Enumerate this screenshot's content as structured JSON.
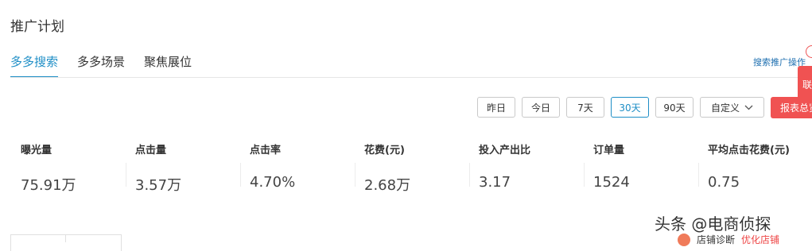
{
  "page": {
    "title": "推广计划"
  },
  "tabs": [
    {
      "label": "多多搜索",
      "active": true
    },
    {
      "label": "多多场景",
      "active": false
    },
    {
      "label": "聚焦展位",
      "active": false
    }
  ],
  "help_link": "搜索推广操作",
  "side_tab_label": "联",
  "date_filters": [
    {
      "label": "昨日",
      "active": false
    },
    {
      "label": "今日",
      "active": false
    },
    {
      "label": "7天",
      "active": false
    },
    {
      "label": "30天",
      "active": true
    },
    {
      "label": "90天",
      "active": false
    }
  ],
  "custom_range": {
    "label": "自定义",
    "icon": "chevron-down-icon"
  },
  "report_button": "报表总览",
  "metrics": [
    {
      "label": "曝光量",
      "value": "75.91万"
    },
    {
      "label": "点击量",
      "value": "3.57万"
    },
    {
      "label": "点击率",
      "value": "4.70%"
    },
    {
      "label": "花费(元)",
      "value": "2.68万"
    },
    {
      "label": "投入产出比",
      "value": "3.17"
    },
    {
      "label": "订单量",
      "value": "1524"
    },
    {
      "label": "平均点击花费(元)",
      "value": "0.75"
    }
  ],
  "watermark": "头条 @电商侦探",
  "bottom_tag": {
    "text": "店铺诊断",
    "highlight": "优化店铺"
  },
  "colors": {
    "accent": "#1e8ec6",
    "danger": "#f05252"
  }
}
